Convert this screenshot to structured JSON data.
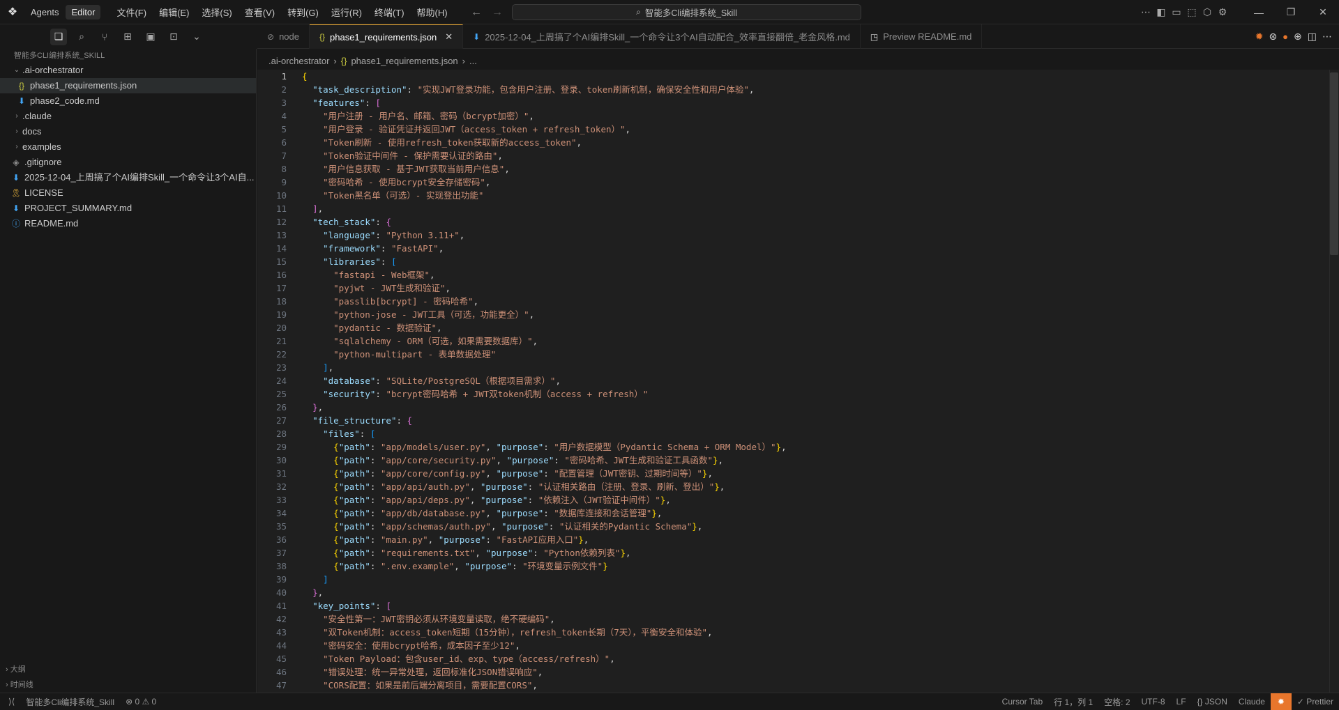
{
  "titlebar": {
    "modes": [
      "Agents",
      "Editor"
    ],
    "menus": [
      "文件(F)",
      "编辑(E)",
      "选择(S)",
      "查看(V)",
      "转到(G)",
      "运行(R)",
      "终端(T)",
      "帮助(H)"
    ],
    "search_text": "智能多Cli编排系统_Skill",
    "window_controls": [
      "minimize-icon",
      "restore-icon",
      "close-icon"
    ]
  },
  "sidebar": {
    "header": "智能多CLI编排系统_SKILL",
    "tree": [
      {
        "label": ".ai-orchestrator",
        "type": "folder-open",
        "depth": 0
      },
      {
        "label": "phase1_requirements.json",
        "type": "json",
        "depth": 1,
        "selected": true
      },
      {
        "label": "phase2_code.md",
        "type": "md",
        "depth": 1
      },
      {
        "label": ".claude",
        "type": "folder",
        "depth": 0
      },
      {
        "label": "docs",
        "type": "folder",
        "depth": 0
      },
      {
        "label": "examples",
        "type": "folder",
        "depth": 0
      },
      {
        "label": ".gitignore",
        "type": "git",
        "depth": 0
      },
      {
        "label": "2025-12-04_上周搞了个AI编排Skill_一个命令让3个AI自...",
        "type": "md",
        "depth": 0
      },
      {
        "label": "LICENSE",
        "type": "license",
        "depth": 0
      },
      {
        "label": "PROJECT_SUMMARY.md",
        "type": "md",
        "depth": 0
      },
      {
        "label": "README.md",
        "type": "info",
        "depth": 0
      }
    ],
    "bottom": [
      "大纲",
      "时间线"
    ]
  },
  "tabs": [
    {
      "label": "node",
      "icon": "terminal-icon",
      "active": false
    },
    {
      "label": "phase1_requirements.json",
      "icon": "json",
      "active": true
    },
    {
      "label": "2025-12-04_上周搞了个AI编排Skill_一个命令让3个AI自动配合_效率直接翻倍_老金风格.md",
      "icon": "md",
      "active": false
    },
    {
      "label": "Preview README.md",
      "icon": "preview",
      "active": false
    }
  ],
  "breadcrumb": [
    ".ai-orchestrator",
    "phase1_requirements.json",
    "..."
  ],
  "code_lines": [
    "{",
    "  \"task_description\": \"实现JWT登录功能，包含用户注册、登录、token刷新机制，确保安全性和用户体验\",",
    "  \"features\": [",
    "    \"用户注册 - 用户名、邮箱、密码（bcrypt加密）\",",
    "    \"用户登录 - 验证凭证并返回JWT（access_token + refresh_token）\",",
    "    \"Token刷新 - 使用refresh_token获取新的access_token\",",
    "    \"Token验证中间件 - 保护需要认证的路由\",",
    "    \"用户信息获取 - 基于JWT获取当前用户信息\",",
    "    \"密码哈希 - 使用bcrypt安全存储密码\",",
    "    \"Token黑名单（可选）- 实现登出功能\"",
    "  ],",
    "  \"tech_stack\": {",
    "    \"language\": \"Python 3.11+\",",
    "    \"framework\": \"FastAPI\",",
    "    \"libraries\": [",
    "      \"fastapi - Web框架\",",
    "      \"pyjwt - JWT生成和验证\",",
    "      \"passlib[bcrypt] - 密码哈希\",",
    "      \"python-jose - JWT工具（可选，功能更全）\",",
    "      \"pydantic - 数据验证\",",
    "      \"sqlalchemy - ORM（可选，如果需要数据库）\",",
    "      \"python-multipart - 表单数据处理\"",
    "    ],",
    "    \"database\": \"SQLite/PostgreSQL（根据项目需求）\",",
    "    \"security\": \"bcrypt密码哈希 + JWT双token机制（access + refresh）\"",
    "  },",
    "  \"file_structure\": {",
    "    \"files\": [",
    "      {\"path\": \"app/models/user.py\", \"purpose\": \"用户数据模型（Pydantic Schema + ORM Model）\"},",
    "      {\"path\": \"app/core/security.py\", \"purpose\": \"密码哈希、JWT生成和验证工具函数\"},",
    "      {\"path\": \"app/core/config.py\", \"purpose\": \"配置管理（JWT密钥、过期时间等）\"},",
    "      {\"path\": \"app/api/auth.py\", \"purpose\": \"认证相关路由（注册、登录、刷新、登出）\"},",
    "      {\"path\": \"app/api/deps.py\", \"purpose\": \"依赖注入（JWT验证中间件）\"},",
    "      {\"path\": \"app/db/database.py\", \"purpose\": \"数据库连接和会话管理\"},",
    "      {\"path\": \"app/schemas/auth.py\", \"purpose\": \"认证相关的Pydantic Schema\"},",
    "      {\"path\": \"main.py\", \"purpose\": \"FastAPI应用入口\"},",
    "      {\"path\": \"requirements.txt\", \"purpose\": \"Python依赖列表\"},",
    "      {\"path\": \".env.example\", \"purpose\": \"环境变量示例文件\"}",
    "    ]",
    "  },",
    "  \"key_points\": [",
    "    \"安全性第一：JWT密钥必须从环境变量读取，绝不硬编码\",",
    "    \"双Token机制：access_token短期（15分钟），refresh_token长期（7天），平衡安全和体验\",",
    "    \"密码安全：使用bcrypt哈希，成本因子至少12\",",
    "    \"Token Payload：包含user_id、exp、type（access/refresh）\",",
    "    \"错误处理：统一异常处理，返回标准化JSON错误响应\",",
    "    \"CORS配置：如果是前后端分离项目，需要配置CORS\","
  ],
  "statusbar": {
    "workspace": "智能多Cli编排系统_Skill",
    "problems": "⊗ 0 ⚠ 0",
    "right_items": [
      "Cursor Tab",
      "行 1，列 1",
      "空格: 2",
      "UTF-8",
      "LF",
      "{} JSON",
      "Claude"
    ],
    "prettier": "✓ Prettier"
  },
  "colors": {
    "accent": "#e8762c",
    "key": "#9cdcfe",
    "string": "#ce9178",
    "bracket1": "#ffd700",
    "bracket2": "#da70d6",
    "bracket3": "#179fff"
  }
}
